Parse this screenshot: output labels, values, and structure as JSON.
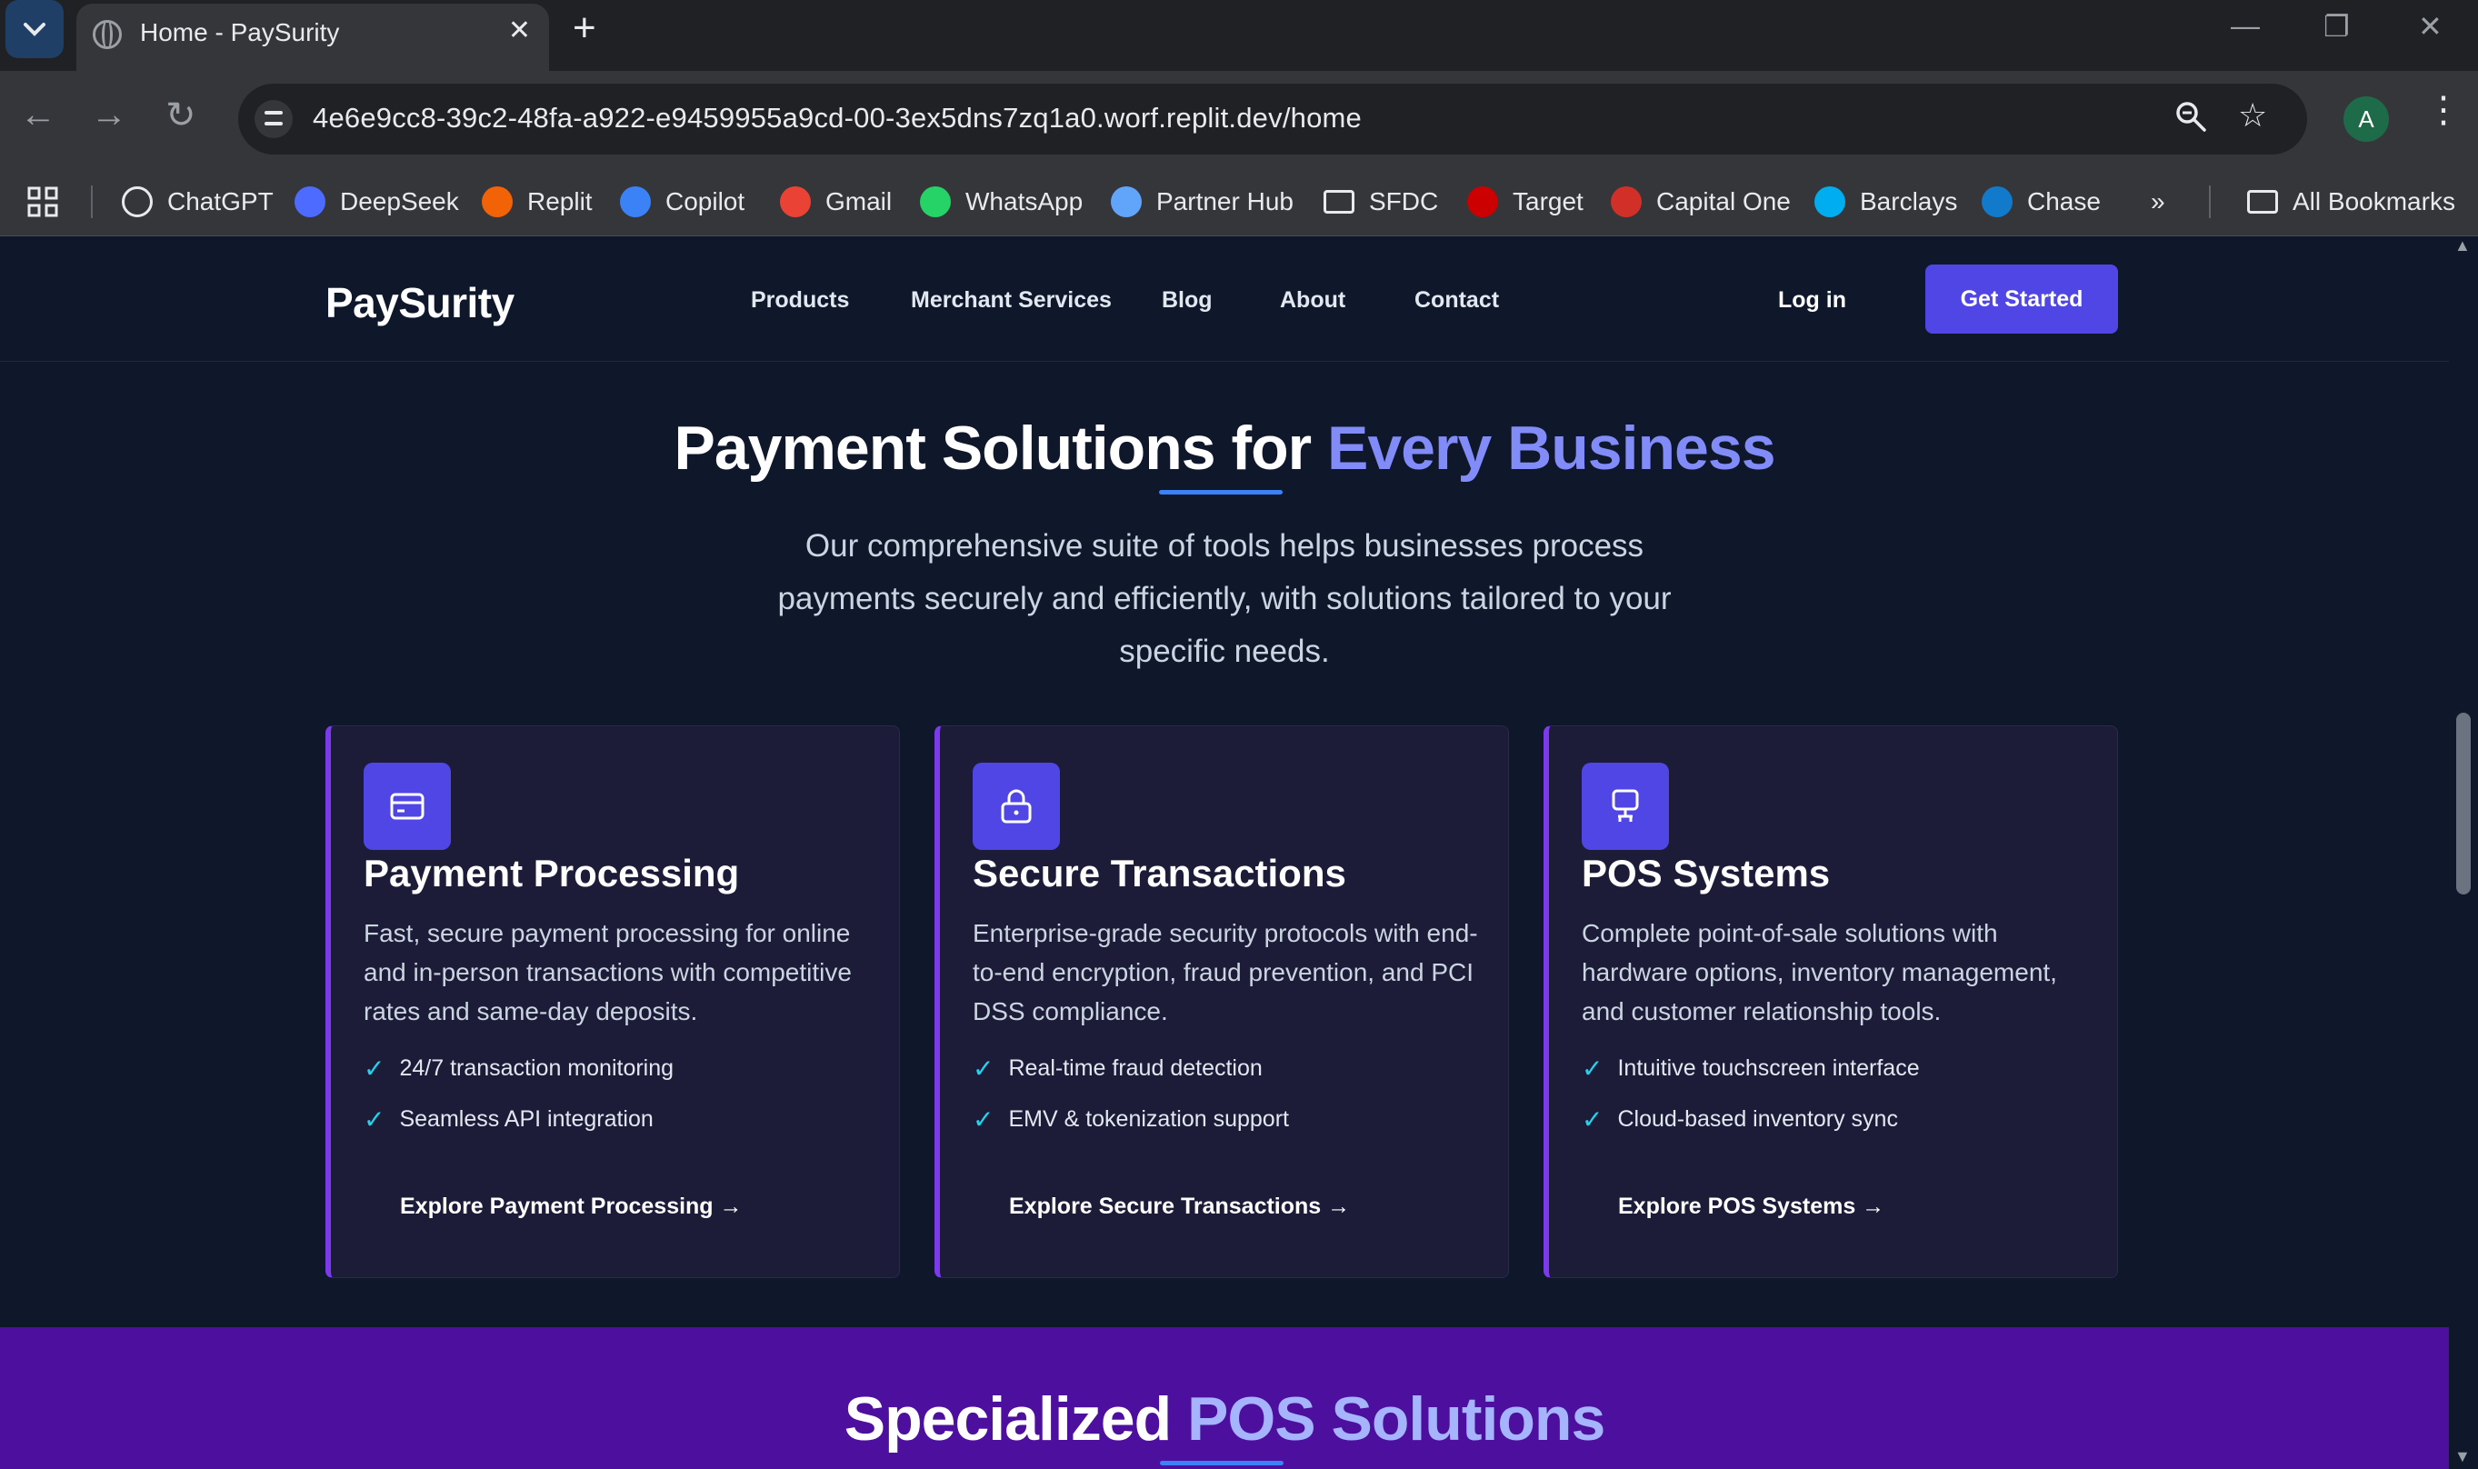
{
  "browser": {
    "tab_title": "Home - PaySurity",
    "url": "4e6e9cc8-39c2-48fa-a922-e9459955a9cd-00-3ex5dns7zq1a0.worf.replit.dev/home",
    "profile_initial": "A",
    "bookmarks": [
      {
        "label": "ChatGPT",
        "icon": "chatgpt-icon",
        "color": "#ffffff"
      },
      {
        "label": "DeepSeek",
        "icon": "deepseek-icon",
        "color": "#4d6bfe"
      },
      {
        "label": "Replit",
        "icon": "replit-icon",
        "color": "#f26207"
      },
      {
        "label": "Copilot",
        "icon": "copilot-icon",
        "color": "#3b82f6"
      },
      {
        "label": "Gmail",
        "icon": "gmail-icon",
        "color": "#ea4335"
      },
      {
        "label": "WhatsApp",
        "icon": "whatsapp-icon",
        "color": "#25d366"
      },
      {
        "label": "Partner Hub",
        "icon": "partner-hub-icon",
        "color": "#60a5fa"
      },
      {
        "label": "SFDC",
        "icon": "folder-icon",
        "color": "#e8eaed"
      },
      {
        "label": "Target",
        "icon": "target-icon",
        "color": "#cc0000"
      },
      {
        "label": "Capital One",
        "icon": "capital-one-icon",
        "color": "#d03027"
      },
      {
        "label": "Barclays",
        "icon": "barclays-icon",
        "color": "#00aeef"
      },
      {
        "label": "Chase",
        "icon": "chase-icon",
        "color": "#117aca"
      }
    ],
    "overflow_label": "»",
    "all_bookmarks": "All Bookmarks"
  },
  "site": {
    "logo": "PaySurity",
    "nav": [
      "Products",
      "Merchant Services",
      "Blog",
      "About",
      "Contact"
    ],
    "login": "Log in",
    "cta": "Get Started",
    "accent_color": "#4f46e5"
  },
  "hero": {
    "title_main": "Payment Solutions for ",
    "title_accent": "Every Business",
    "subtitle": "Our comprehensive suite of tools helps businesses process payments securely and efficiently, with solutions tailored to your specific needs."
  },
  "cards": [
    {
      "icon": "credit-card-icon",
      "title": "Payment Processing",
      "desc": "Fast, secure payment processing for online and in-person transactions with competitive rates and same-day deposits.",
      "features": [
        "24/7 transaction monitoring",
        "Seamless API integration"
      ],
      "link": "Explore Payment Processing →"
    },
    {
      "icon": "lock-icon",
      "title": "Secure Transactions",
      "desc": "Enterprise-grade security protocols with end-to-end encryption, fraud prevention, and PCI DSS compliance.",
      "features": [
        "Real-time fraud detection",
        "EMV & tokenization support"
      ],
      "link": "Explore Secure Transactions →"
    },
    {
      "icon": "pos-terminal-icon",
      "title": "POS Systems",
      "desc": "Complete point-of-sale solutions with hardware options, inventory management, and customer relationship tools.",
      "features": [
        "Intuitive touchscreen interface",
        "Cloud-based inventory sync"
      ],
      "link": "Explore POS Systems →"
    }
  ],
  "pos_section": {
    "title_main": "Specialized ",
    "title_accent": "POS Solutions"
  }
}
